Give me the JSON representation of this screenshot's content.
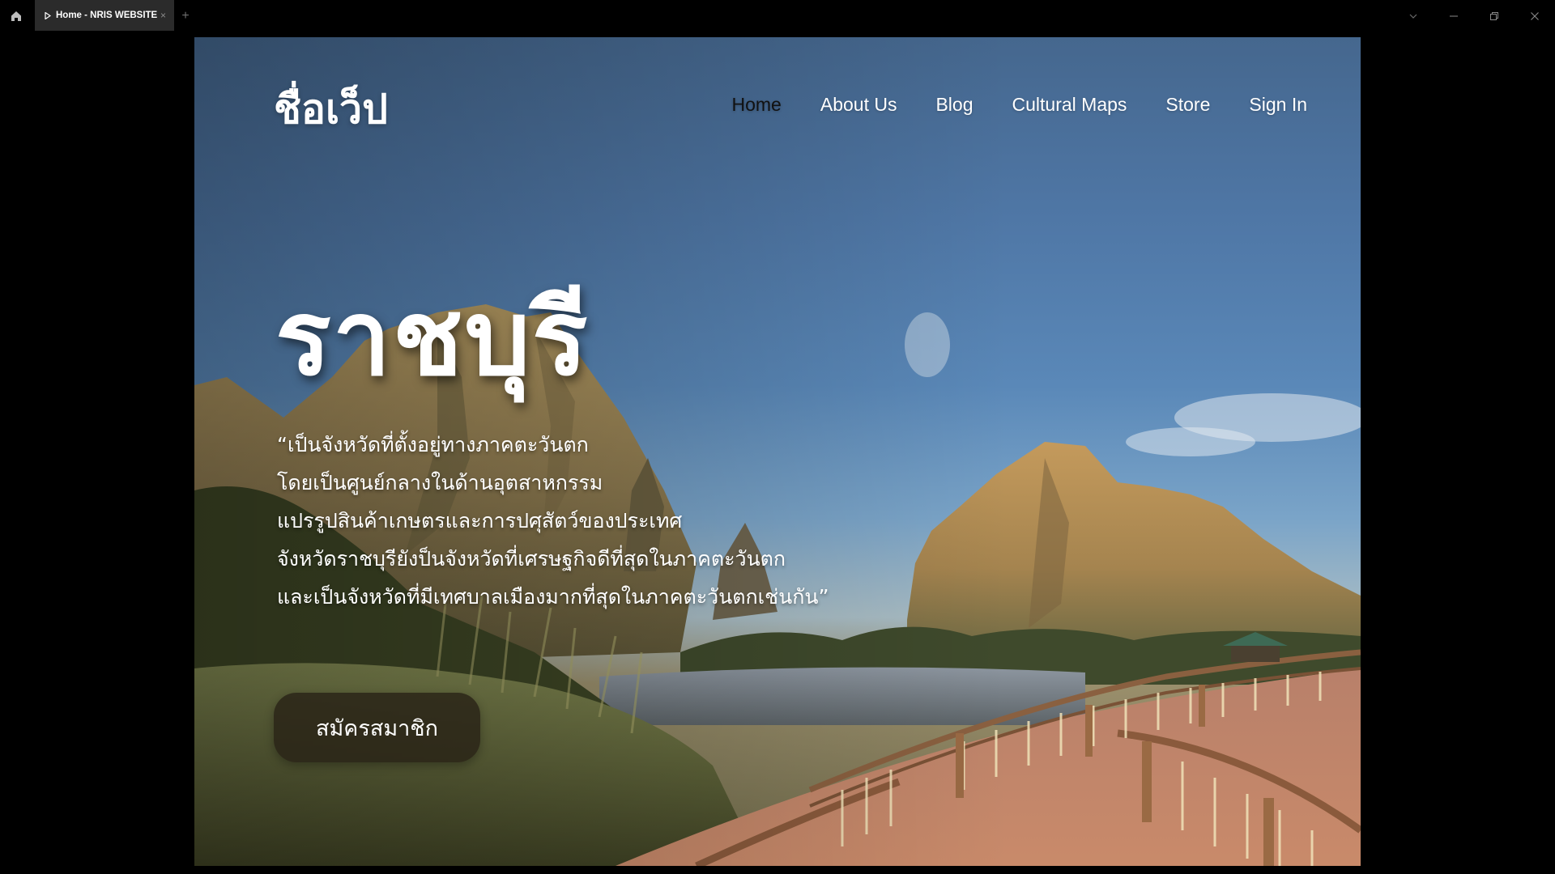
{
  "browser": {
    "tab_title": "Home - NRIS WEBSITE",
    "close_glyph": "×",
    "new_tab_glyph": "+"
  },
  "site": {
    "logo": "ชื่อเว็ป",
    "nav": [
      {
        "label": "Home",
        "active": true
      },
      {
        "label": "About Us",
        "active": false
      },
      {
        "label": "Blog",
        "active": false
      },
      {
        "label": "Cultural Maps",
        "active": false
      },
      {
        "label": "Store",
        "active": false
      },
      {
        "label": "Sign In",
        "active": false
      }
    ]
  },
  "hero": {
    "title": "ราชบุรี",
    "description_lines": [
      "“เป็นจังหวัดที่ตั้งอยู่ทางภาคตะวันตก",
      "โดยเป็นศูนย์กลางในด้านอุตสาหกรรม",
      "แปรรูปสินค้าเกษตรและการปศุสัตว์ของประเทศ",
      "จังหวัดราชบุรียังป็นจังหวัดที่เศรษฐกิจดีที่สุดในภาคตะวันตก",
      "และเป็นจังหวัดที่มีเทศบาลเมืองมากที่สุดในภาคตะวันตกเช่นกัน”"
    ],
    "cta_label": "สมัครสมาชิก"
  },
  "colors": {
    "nav_active": "#111111",
    "nav_default": "#ffffff",
    "cta_bg": "#282216"
  }
}
